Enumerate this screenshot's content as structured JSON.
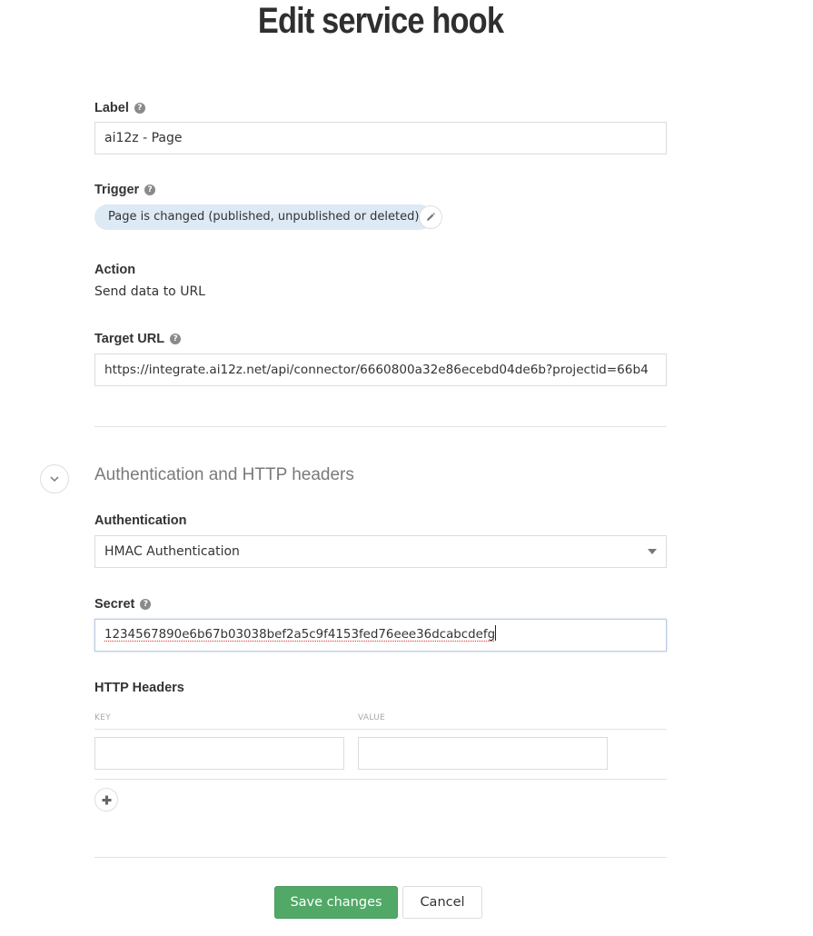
{
  "page": {
    "title": "Edit service hook"
  },
  "form": {
    "label": {
      "label": "Label",
      "help_icon": "?",
      "value": "ai12z - Page"
    },
    "trigger": {
      "label": "Trigger",
      "help_icon": "?",
      "value": "Page is changed (published, unpublished or deleted)",
      "edit_icon": "pencil-icon"
    },
    "action": {
      "label": "Action",
      "value": "Send data to URL"
    },
    "target_url": {
      "label": "Target URL",
      "help_icon": "?",
      "value": "https://integrate.ai12z.net/api/connector/6660800a32e86ecebd04de6b?projectid=66b4"
    }
  },
  "auth_section": {
    "title": "Authentication and HTTP headers",
    "toggle_icon": "chevron-down-icon",
    "authentication": {
      "label": "Authentication",
      "selected": "HMAC Authentication"
    },
    "secret": {
      "label": "Secret",
      "help_icon": "?",
      "value": "1234567890e6b67b03038bef2a5c9f4153fed76eee36dcabcdefg"
    },
    "http_headers": {
      "label": "HTTP Headers",
      "columns": [
        "KEY",
        "VALUE"
      ],
      "rows": [
        {
          "key": "",
          "value": ""
        }
      ],
      "add_icon": "plus-icon"
    }
  },
  "footer": {
    "save_label": "Save changes",
    "cancel_label": "Cancel"
  },
  "colors": {
    "primary": "#52a867",
    "pill": "#dde9f4"
  }
}
